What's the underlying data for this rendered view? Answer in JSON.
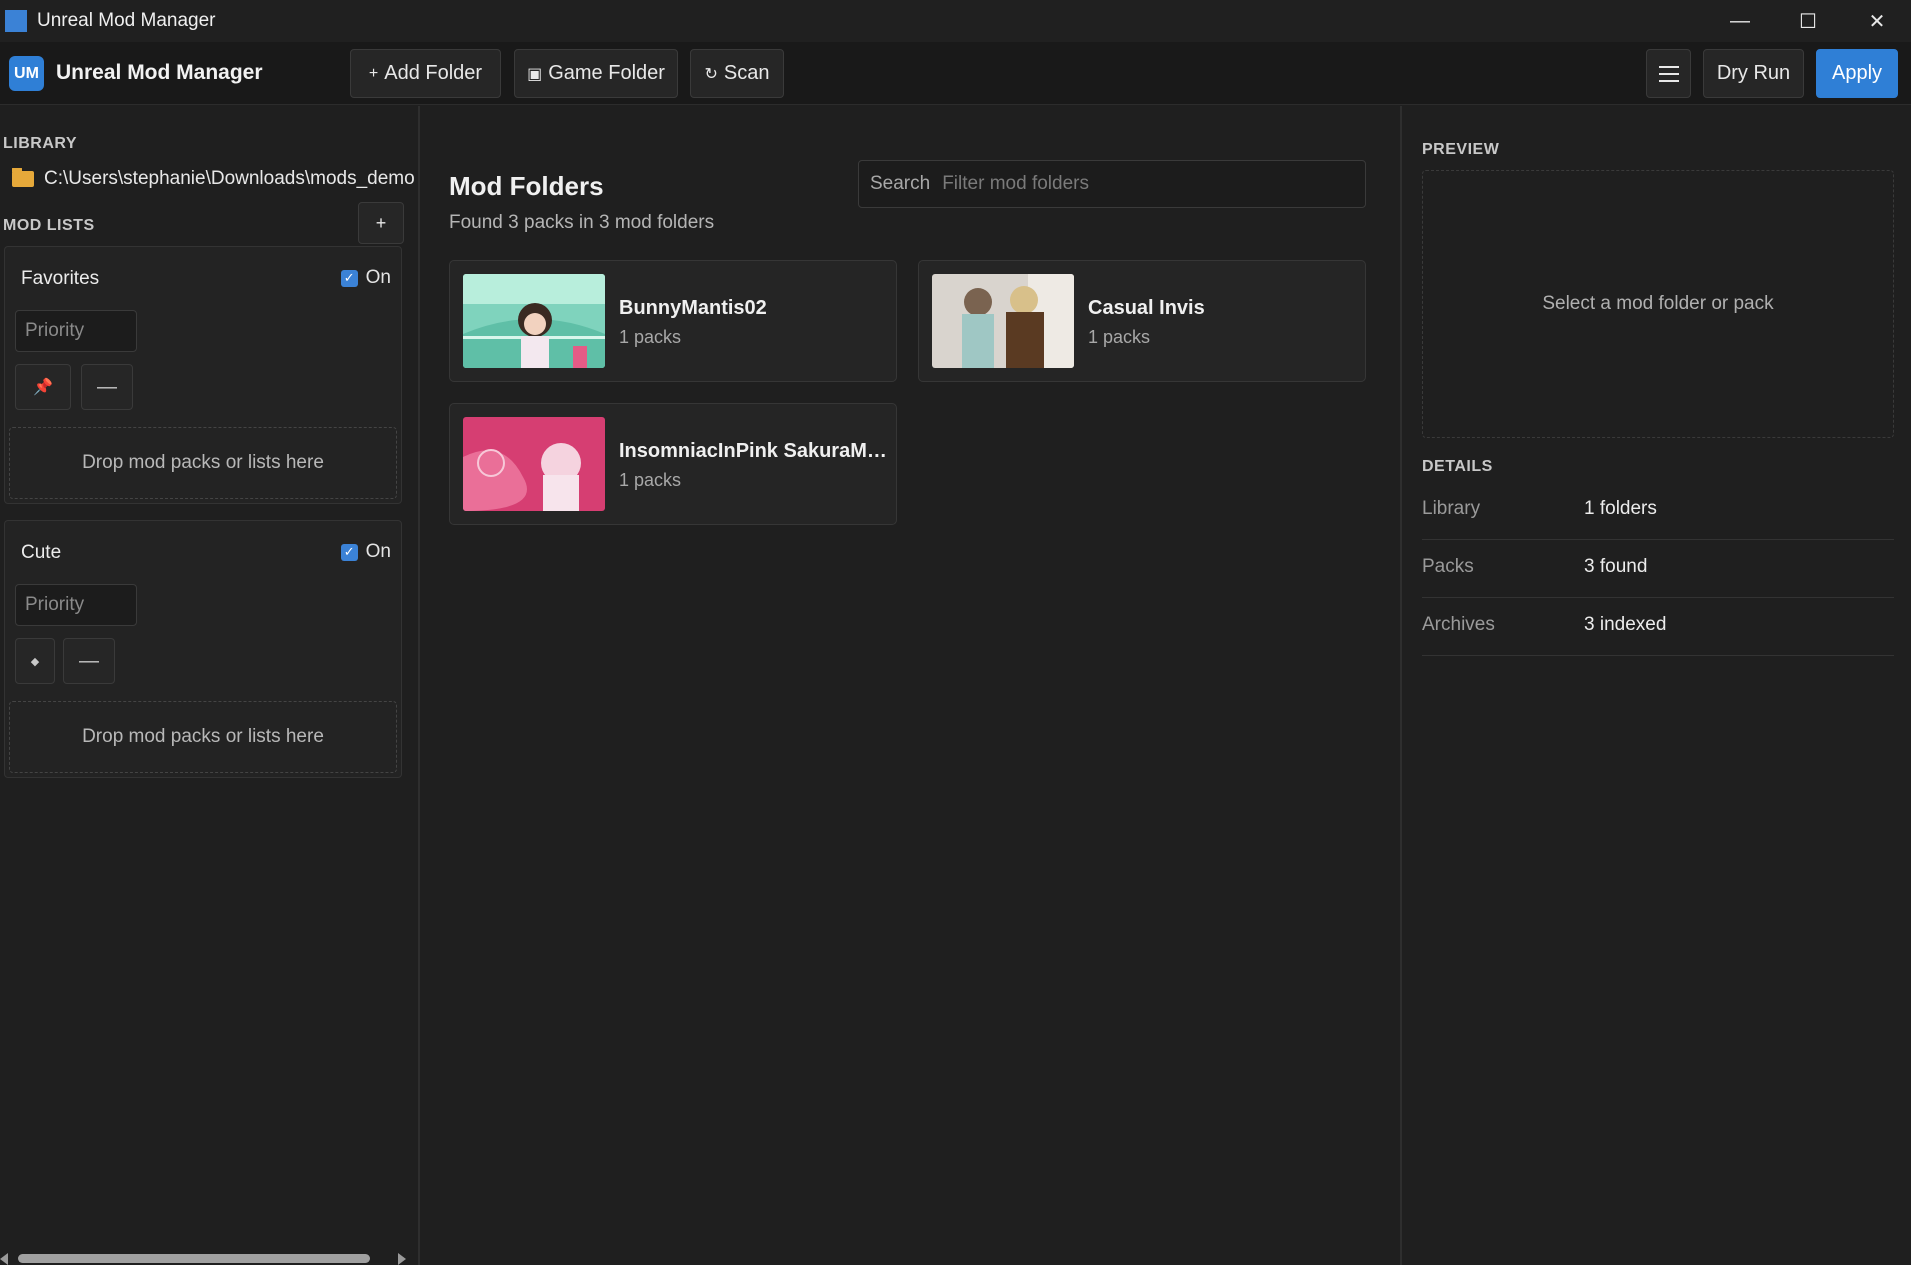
{
  "window": {
    "title": "Unreal Mod Manager",
    "controls": {
      "minimize": "—",
      "maximize": "☐",
      "close": "✕"
    }
  },
  "toolbar": {
    "logo": "UM",
    "brand": "Unreal Mod Manager",
    "add_folder": {
      "icon": "+",
      "label": "Add Folder"
    },
    "game_folder": {
      "icon": "▣",
      "label": "Game Folder"
    },
    "scan": {
      "icon": "↻",
      "label": "Scan"
    },
    "dry_run": "Dry Run",
    "apply": "Apply",
    "accent_color": "#2f7fd6"
  },
  "sidebar": {
    "library_label": "LIBRARY",
    "library_path": "C:\\Users\\stephanie\\Downloads\\mods_demo",
    "mod_lists_label": "MOD LISTS",
    "add_list_label": "+",
    "lists": [
      {
        "name": "Favorites",
        "toggle_label": "On",
        "enabled": true,
        "priority_placeholder": "Priority",
        "pin_icon": "📌",
        "remove_label": "—",
        "drop_text": "Drop mod packs or lists here"
      },
      {
        "name": "Cute",
        "toggle_label": "On",
        "enabled": true,
        "priority_placeholder": "Priority",
        "pin_icon": "◆",
        "remove_label": "—",
        "drop_text": "Drop mod packs or lists here"
      }
    ]
  },
  "main": {
    "title": "Mod Folders",
    "subtitle": "Found 3 packs in 3 mod folders",
    "search": {
      "label": "Search",
      "placeholder": "Filter mod folders"
    },
    "mods": [
      {
        "name": "BunnyMantis02",
        "count": "1 packs"
      },
      {
        "name": "Casual Invis",
        "count": "1 packs"
      },
      {
        "name": "InsomniacInPink SakuraMilk Peri",
        "count": "1 packs"
      }
    ]
  },
  "right": {
    "preview_label": "PREVIEW",
    "preview_empty": "Select a mod folder or pack",
    "details_label": "DETAILS",
    "details": [
      {
        "key": "Library",
        "value": "1 folders"
      },
      {
        "key": "Packs",
        "value": "3 found"
      },
      {
        "key": "Archives",
        "value": "3 indexed"
      }
    ]
  }
}
